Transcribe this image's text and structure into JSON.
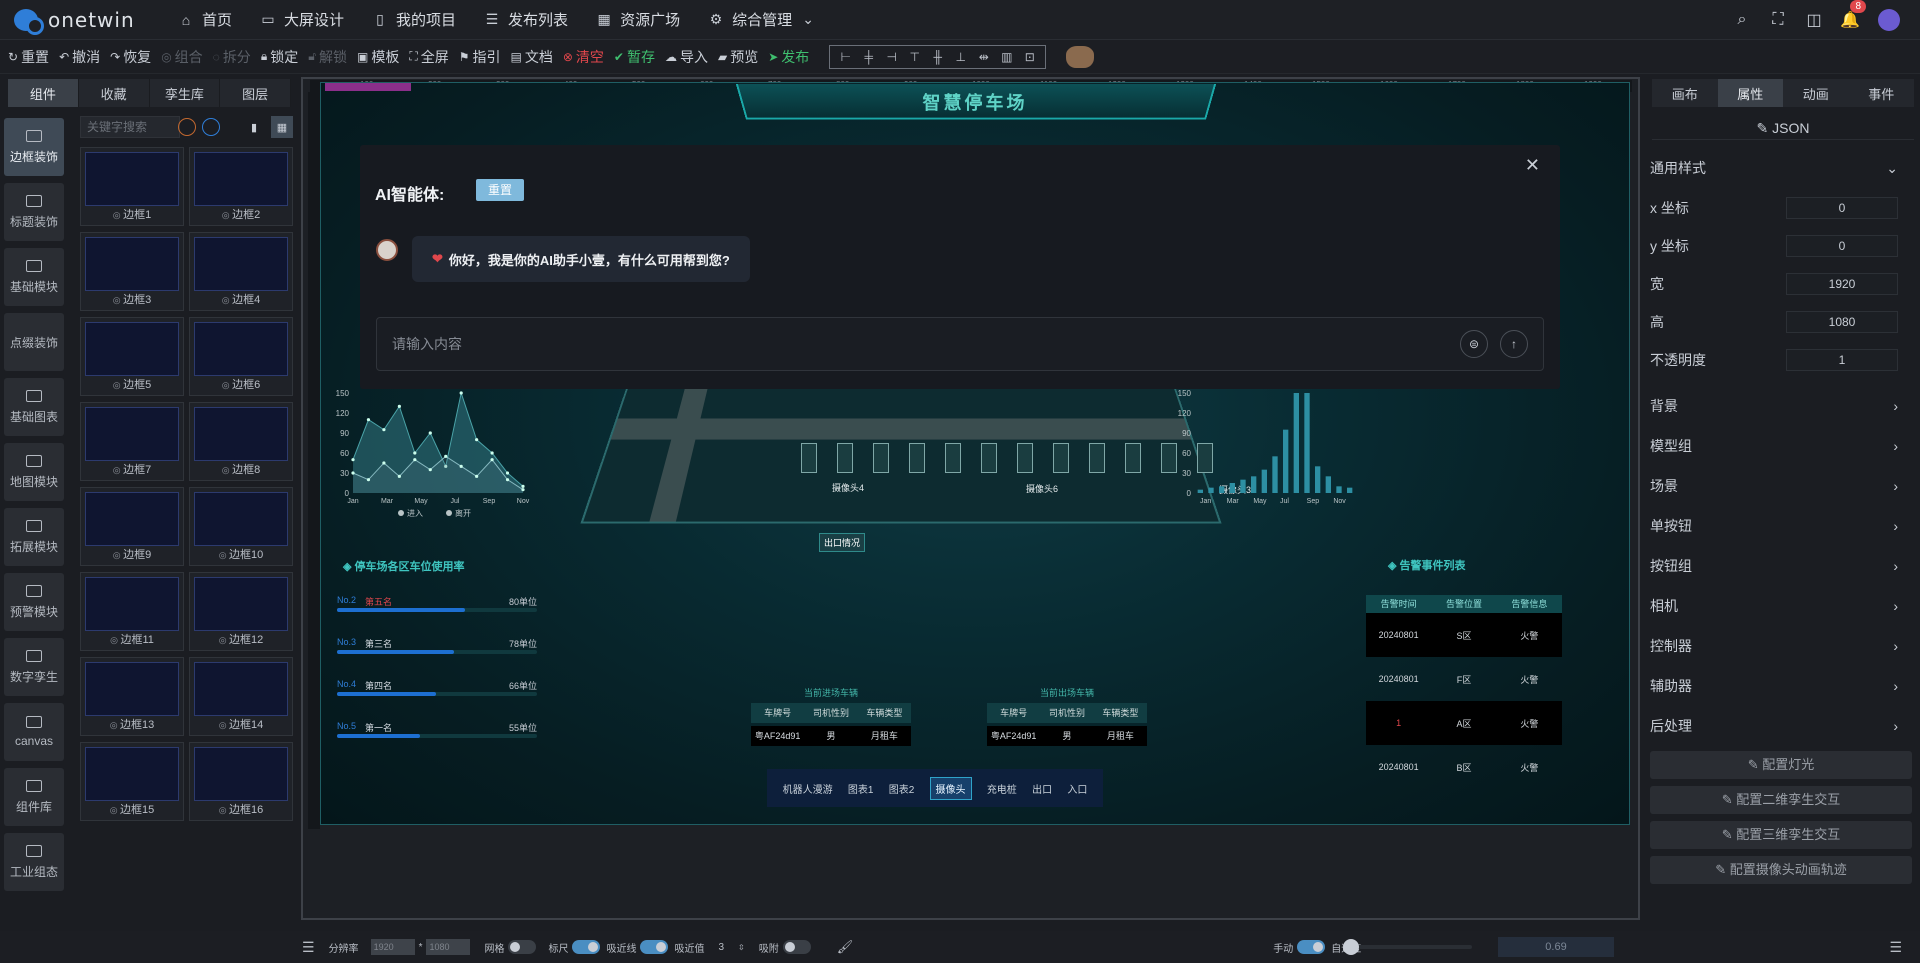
{
  "app": {
    "brand": "onetwin"
  },
  "nav": [
    {
      "label": "首页",
      "icon": "home-icon"
    },
    {
      "label": "大屏设计",
      "icon": "monitor-icon"
    },
    {
      "label": "我的项目",
      "icon": "book-icon"
    },
    {
      "label": "发布列表",
      "icon": "list-icon"
    },
    {
      "label": "资源广场",
      "icon": "apps-icon"
    },
    {
      "label": "综合管理",
      "icon": "gear-icon"
    }
  ],
  "topright": {
    "notification_count": "8"
  },
  "toolbar": {
    "reset": "重置",
    "undo": "撤消",
    "redo": "恢复",
    "group": "组合",
    "split": "拆分",
    "lock": "锁定",
    "unlock": "解锁",
    "template": "模板",
    "fullscreen": "全屏",
    "guide": "指引",
    "doc": "文档",
    "clear": "清空",
    "save_draft": "暂存",
    "import": "导入",
    "preview": "预览",
    "publish": "发布"
  },
  "left_tabs": [
    "组件",
    "收藏",
    "孪生库",
    "图层"
  ],
  "categories": [
    "边框装饰",
    "标题装饰",
    "基础模块",
    "点缀装饰",
    "基础图表",
    "地图模块",
    "拓展模块",
    "预警模块",
    "数字孪生",
    "canvas",
    "组件库",
    "工业组态"
  ],
  "search": {
    "placeholder": "关键字搜索"
  },
  "components": [
    "边框1",
    "边框2",
    "边框3",
    "边框4",
    "边框5",
    "边框6",
    "边框7",
    "边框8",
    "边框9",
    "边框10",
    "边框11",
    "边框12",
    "边框13",
    "边框14",
    "边框15",
    "边框16"
  ],
  "ruler_ticks": [
    "100",
    "200",
    "300",
    "400",
    "500",
    "600",
    "700",
    "800",
    "900",
    "1000",
    "1100",
    "1200",
    "1300",
    "1400",
    "1500",
    "1600",
    "1700",
    "1800",
    "1900"
  ],
  "dashboard": {
    "title": "智慧停车场",
    "left_panel_title": "停车场各区车位使用率",
    "left_chart": {
      "type": "area",
      "categories": [
        "Jan",
        "Mar",
        "May",
        "Jul",
        "Sep",
        "Nov"
      ],
      "yticks": [
        "150",
        "120",
        "90",
        "60",
        "30",
        "0"
      ],
      "legend": [
        "进入",
        "离开"
      ],
      "series": [
        {
          "name": "进入",
          "values": [
            50,
            110,
            95,
            130,
            60,
            90,
            40,
            150,
            80,
            60,
            30,
            10
          ]
        },
        {
          "name": "离开",
          "values": [
            30,
            20,
            45,
            25,
            50,
            35,
            55,
            40,
            25,
            50,
            20,
            5
          ]
        }
      ],
      "ylim": [
        0,
        150
      ]
    },
    "ranks": [
      {
        "no": "No.2",
        "name": "第五名",
        "value": "80单位",
        "ratio": 0.85,
        "red": true
      },
      {
        "no": "No.3",
        "name": "第三名",
        "value": "78单位",
        "ratio": 0.78,
        "red": false
      },
      {
        "no": "No.4",
        "name": "第四名",
        "value": "66单位",
        "ratio": 0.66,
        "red": false
      },
      {
        "no": "No.5",
        "name": "第一名",
        "value": "55单位",
        "ratio": 0.55,
        "red": false
      }
    ],
    "cameras": [
      "摄像头4",
      "摄像头6",
      "摄像头3"
    ],
    "exit_label": "出口情况",
    "right_chart": {
      "type": "bar",
      "categories": [
        "Jan",
        "Mar",
        "May",
        "Jul",
        "Sep",
        "Nov"
      ],
      "yticks": [
        "150",
        "120",
        "90",
        "60",
        "30",
        "0"
      ],
      "values": [
        5,
        8,
        10,
        15,
        20,
        25,
        35,
        55,
        95,
        160,
        180,
        40,
        25,
        10,
        8
      ],
      "ylim": [
        0,
        150
      ]
    },
    "right_panel_title": "告警事件列表",
    "right_top_label": "收",
    "alarm_headers": [
      "告警时间",
      "告警位置",
      "告警信息"
    ],
    "alarms": [
      {
        "time": "20240801",
        "pos": "S区",
        "info": "火警"
      },
      {
        "time": "20240801",
        "pos": "F区",
        "info": "火警"
      },
      {
        "time": "1",
        "pos": "A区",
        "info": "火警"
      },
      {
        "time": "20240801",
        "pos": "B区",
        "info": "火警"
      }
    ],
    "in_table": {
      "title": "当前进场车辆",
      "headers": [
        "车牌号",
        "司机性别",
        "车辆类型"
      ],
      "row": [
        "粤AF24d91",
        "男",
        "月租车"
      ]
    },
    "out_table": {
      "title": "当前出场车辆",
      "headers": [
        "车牌号",
        "司机性别",
        "车辆类型"
      ],
      "row": [
        "粤AF24d91",
        "男",
        "月租车"
      ]
    },
    "tabs": [
      "机器人漫游",
      "图表1",
      "图表2",
      "摄像头",
      "充电桩",
      "出口",
      "入口"
    ]
  },
  "ai_dialog": {
    "title": "AI智能体:",
    "reset": "重置",
    "message": "你好，我是你的AI助手小壹，有什么可用帮到您?",
    "input_placeholder": "请输入内容"
  },
  "right_tabs": [
    "画布",
    "属性",
    "动画",
    "事件"
  ],
  "json_label": "JSON",
  "props": {
    "section": "通用样式",
    "items": [
      {
        "label": "x 坐标",
        "value": "0"
      },
      {
        "label": "y 坐标",
        "value": "0"
      },
      {
        "label": "宽",
        "value": "1920"
      },
      {
        "label": "高",
        "value": "1080"
      },
      {
        "label": "不透明度",
        "value": "1"
      }
    ],
    "groups": [
      "背景",
      "模型组",
      "场景",
      "单按钮",
      "按钮组",
      "相机",
      "控制器",
      "辅助器",
      "后处理"
    ],
    "config_buttons": [
      "配置灯光",
      "配置二维孪生交互",
      "配置三维孪生交互",
      "配置摄像头动画轨迹"
    ]
  },
  "statusbar": {
    "resolution_label": "分辨率",
    "res_w": "1920",
    "res_h": "1080",
    "grid": "网格",
    "ruler": "标尺",
    "snap": "吸近线",
    "snap_value_label": "吸近值",
    "snap_value": "3",
    "bind": "吸附",
    "manual": "手动",
    "adaptive": "自适应",
    "zoom": "0.69"
  }
}
